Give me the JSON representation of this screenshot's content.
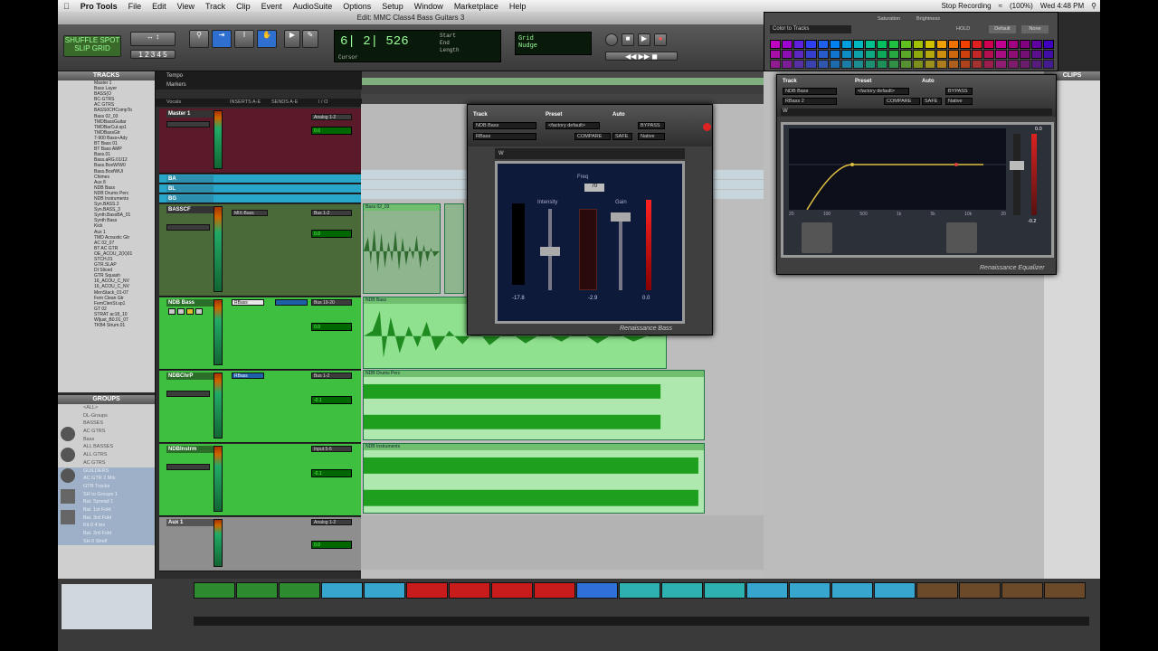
{
  "menubar": {
    "app_name": "Pro Tools",
    "items": [
      "File",
      "Edit",
      "View",
      "Track",
      "Clip",
      "Event",
      "AudioSuite",
      "Options",
      "Setup",
      "Window",
      "Marketplace",
      "Help"
    ],
    "status": "Stop Recording",
    "clock": "Wed 4:48 PM",
    "battery": "(100%)"
  },
  "window_title": "Edit: MMC Class4 Bass Guitars 3",
  "transport": {
    "main_counter": "6| 2| 526",
    "start_label": "Start",
    "end_label": "End",
    "length_label": "Length",
    "cursor_label": "Cursor",
    "nudge_label": "Nudge",
    "grid_label": "Grid"
  },
  "rulers": [
    "Tempo",
    "Markers"
  ],
  "tracks_panel": {
    "title": "TRACKS",
    "items": [
      "Master 1",
      "Bass Layer",
      "BASS(O",
      "BC-GTRS",
      "AC GTRS",
      "BASS0CHCompTo",
      "Bass 02_03",
      "TMDBassGuitar",
      "TMDBarCut.sp1",
      "TMDBassGtr",
      "7-900 Bass+Ady",
      "BT Bass 01",
      "BT Bass AMP",
      "Bass.01",
      "Bass.aRG.01/12",
      "Bass.BoxW/W0",
      "Bass.BoxfWUl",
      "Chimes",
      "Aux 8",
      "NDB Bass",
      "NDB Drums Perc",
      "NDB Instruments",
      "Syn.BASS.2",
      "Syn.BASS_3",
      "Synth.BassBA_01",
      "Synth Bass",
      "Kick",
      "Aux 1",
      "TMD Acoustic Gtr",
      "AC 02_07",
      "BT AC GTR",
      "OE_ACOU_2(X)01",
      "STCH.01",
      "GTR.SLAP",
      "DI Sliced",
      "GTR Squash",
      "16_ACOU_C_NV",
      "16_ACOU_C_NV",
      "MenStack_01-07",
      "Fem Clean Gtr",
      "FemClenSt.sp1",
      "GT 02",
      "STRAT ac18_10",
      "Wljust_B0.01_07",
      "TKB4 Strum.01"
    ]
  },
  "groups_panel": {
    "title": "GROUPS",
    "items": [
      "<ALL>",
      "DL-Groups",
      "BASSES",
      "AC GTRS",
      "Bass",
      "ALL BASSES",
      "ALL GTRS",
      "AC GTRS",
      "GUILDERS",
      "AC GTR 2 Mix",
      "GTR Tracks",
      "SH to Groups 1",
      "Bal. Spread 1",
      "Bal. 1st Fold",
      "Bal. 3rd Fold",
      "Kit 0 4 bis",
      "Bal. 3rd Fold",
      "SH 0 Shelf"
    ]
  },
  "mix_header": {
    "name_col": "Vocals",
    "inserts_col": "INSERTS A-E",
    "sends_col": "SENDS A-E",
    "io_col": "I / O"
  },
  "strips": [
    {
      "name": "Master 1",
      "volume": "0.0",
      "insert": "",
      "output": "Analog 1-2"
    },
    {
      "name": "BA",
      "volume": "",
      "insert": "",
      "output": ""
    },
    {
      "name": "BL",
      "volume": "",
      "insert": "",
      "output": ""
    },
    {
      "name": "BG",
      "volume": "",
      "insert": "",
      "output": ""
    },
    {
      "name": "BASSCF",
      "volume": "0.0",
      "insert": "MIX-Bass",
      "output": "Bus 1-2"
    },
    {
      "name": "NDB Bass",
      "volume": "0.0",
      "insert": "RBass",
      "output": "Bus 19-20"
    },
    {
      "name": "NDBChrP",
      "volume": "-0.1",
      "insert": "RBass",
      "output": "Bus 1-2"
    },
    {
      "name": "NDBInstrm",
      "volume": "-0.1",
      "insert": "",
      "output": "Input 5-6"
    },
    {
      "name": "Aux 1",
      "volume": "0.0",
      "insert": "",
      "output": "Analog 1-2"
    }
  ],
  "clips": [
    {
      "name": "Bass 02_03",
      "color": "#2e6e2e"
    },
    {
      "name": "NDB Bass",
      "color": "#2e6e2e"
    },
    {
      "name": "NDB Drums Perc",
      "color": "#2e6e2e"
    },
    {
      "name": "NDB Instruments",
      "color": "#2e6e2e"
    }
  ],
  "plugin_rbass": {
    "track_label": "Track",
    "preset_label": "Preset",
    "auto_label": "Auto",
    "track_value": "NDB Bass",
    "preset_value": "<factory default>",
    "compare": "COMPARE",
    "safe": "SAFE",
    "bypass": "BYPASS",
    "native": "Native",
    "insert_name": "RBass",
    "freq_label": "Freq",
    "freq_value": "70",
    "intensity_label": "Intensity",
    "intensity_value": "-2.3",
    "gain_label": "Gain",
    "gain_value": "0.0",
    "meter_vals": [
      "-17.8",
      "-2.9"
    ],
    "brand": "Renaissance Bass",
    "brand_badge": "W"
  },
  "plugin_rbasseq": {
    "track_label": "Track",
    "preset_label": "Preset",
    "auto_label": "Auto",
    "track_value": "NDB Bass",
    "preset_value": "<factory default>",
    "compare": "COMPARE",
    "safe": "SAFE",
    "bypass": "BYPASS",
    "native": "Native",
    "insert_name": "RBass 2",
    "brand": "Renaissance Equalizer",
    "brand_badge": "W",
    "axis_ticks": [
      "20",
      "100",
      "500",
      "1k",
      "5k",
      "10k",
      "20"
    ],
    "gain_db": "0.0",
    "out_db": "-0.2"
  },
  "color_palette": {
    "title": "Color to Tracks",
    "saturation_label": "Saturation",
    "brightness_label": "Brightness",
    "none_label": "None",
    "default_label": "Default",
    "hold_label": "HOLD",
    "colors": [
      "#c000c0",
      "#a000d0",
      "#6020e0",
      "#3040f0",
      "#2060f0",
      "#0080f0",
      "#00a0e0",
      "#00b8c0",
      "#00c090",
      "#00c060",
      "#20c040",
      "#60c020",
      "#a0c000",
      "#d0c000",
      "#f0a000",
      "#f07000",
      "#f04000",
      "#e02020",
      "#d00050",
      "#c00090",
      "#a00080",
      "#800080",
      "#6000a0",
      "#4000c0"
    ]
  },
  "timeline_segments": [
    "#2e8a2e",
    "#2e8a2e",
    "#2e8a2e",
    "#36a6cf",
    "#36a6cf",
    "#c81c1c",
    "#c81c1c",
    "#c81c1c",
    "#c81c1c",
    "#2f6fd8",
    "#2fb0b0",
    "#2fb0b0",
    "#2fb0b0",
    "#36a6cf",
    "#36a6cf",
    "#36a6cf",
    "#36a6cf",
    "#6b4a2a",
    "#6b4a2a",
    "#6b4a2a",
    "#6b4a2a"
  ],
  "right_header": "CLIPS"
}
